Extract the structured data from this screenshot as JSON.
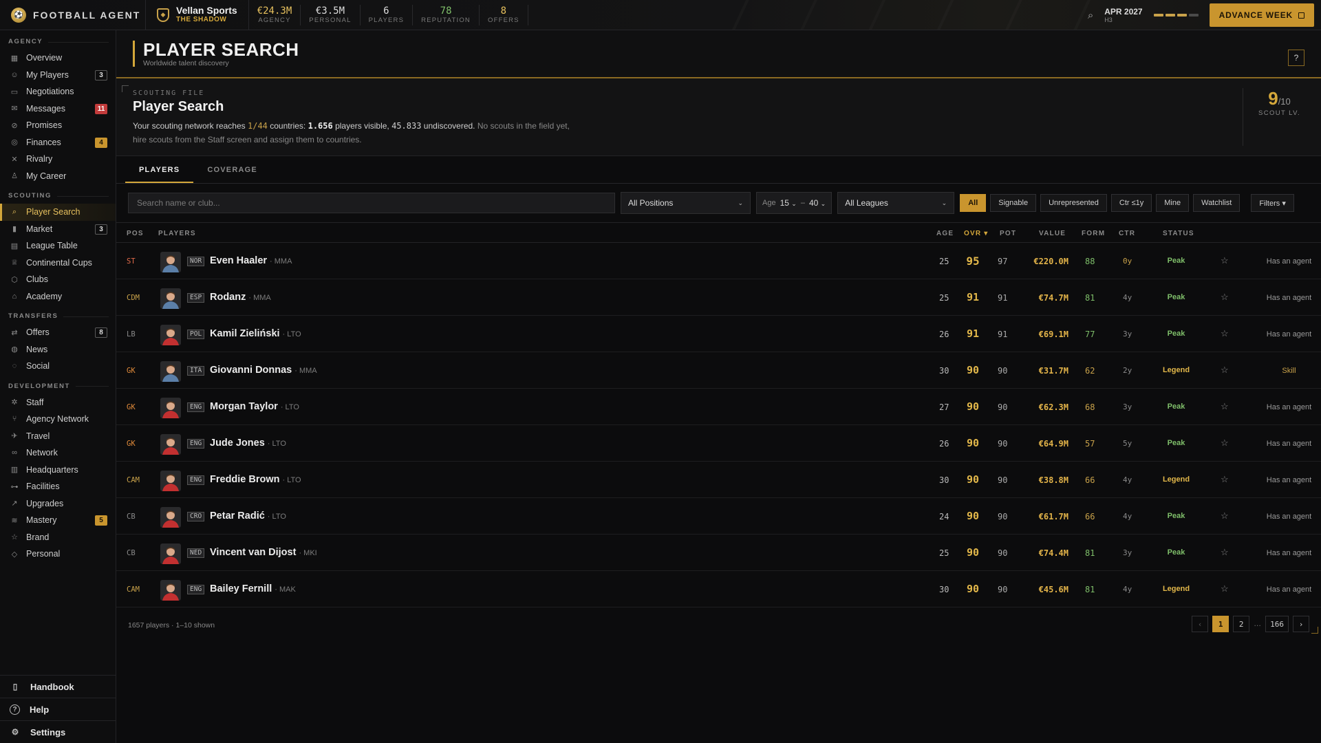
{
  "app": {
    "brand": "FOOTBALL AGENT",
    "logo_icon": "football-icon"
  },
  "agency": {
    "name": "Vellan Sports",
    "tagline": "THE SHADOW"
  },
  "stats": [
    {
      "value": "€24.3M",
      "label": "AGENCY",
      "color": "#e7c15e"
    },
    {
      "value": "€3.5M",
      "label": "PERSONAL",
      "color": "#dddddd"
    },
    {
      "value": "6",
      "label": "PLAYERS",
      "color": "#dddddd"
    },
    {
      "value": "78",
      "label": "REPUTATION",
      "color": "#7fbf6a"
    },
    {
      "value": "8",
      "label": "OFFERS",
      "color": "#e7c15e"
    }
  ],
  "date": {
    "month": "APR 2027",
    "week": "H3",
    "weeks_filled": 3,
    "weeks_total": 4
  },
  "advance_label": "ADVANCE WEEK",
  "sidebar": {
    "sections": [
      {
        "title": "AGENCY",
        "items": [
          {
            "label": "Overview",
            "icon": "grid-icon",
            "glyph": "▦"
          },
          {
            "label": "My Players",
            "icon": "user-icon",
            "glyph": "☺",
            "badge": "3",
            "badge_style": "o"
          },
          {
            "label": "Negotiations",
            "icon": "chat-icon",
            "glyph": "▭"
          },
          {
            "label": "Messages",
            "icon": "mail-icon",
            "glyph": "✉",
            "badge": "11",
            "badge_style": "r"
          },
          {
            "label": "Promises",
            "icon": "link-icon",
            "glyph": "⊘"
          },
          {
            "label": "Finances",
            "icon": "coin-icon",
            "glyph": "◎",
            "badge": "4",
            "badge_style": "y"
          },
          {
            "label": "Rivalry",
            "icon": "swords-icon",
            "glyph": "✕"
          },
          {
            "label": "My Career",
            "icon": "career-icon",
            "glyph": "♙"
          }
        ]
      },
      {
        "title": "SCOUTING",
        "items": [
          {
            "label": "Player Search",
            "icon": "search-icon",
            "glyph": "⌕",
            "active": true
          },
          {
            "label": "Market",
            "icon": "bar-chart-icon",
            "glyph": "▮",
            "badge": "3",
            "badge_style": "o"
          },
          {
            "label": "League Table",
            "icon": "table-icon",
            "glyph": "▤"
          },
          {
            "label": "Continental Cups",
            "icon": "trophy-icon",
            "glyph": "♕"
          },
          {
            "label": "Clubs",
            "icon": "shield-icon",
            "glyph": "⬡"
          },
          {
            "label": "Academy",
            "icon": "academy-icon",
            "glyph": "⌂"
          }
        ]
      },
      {
        "title": "TRANSFERS",
        "items": [
          {
            "label": "Offers",
            "icon": "transfer-icon",
            "glyph": "⇄",
            "badge": "8",
            "badge_style": "o"
          },
          {
            "label": "News",
            "icon": "globe-icon",
            "glyph": "◍"
          },
          {
            "label": "Social",
            "icon": "social-icon",
            "glyph": "◌"
          }
        ]
      },
      {
        "title": "DEVELOPMENT",
        "items": [
          {
            "label": "Staff",
            "icon": "staff-icon",
            "glyph": "✲"
          },
          {
            "label": "Agency Network",
            "icon": "network-icon",
            "glyph": "⑂"
          },
          {
            "label": "Travel",
            "icon": "plane-icon",
            "glyph": "✈"
          },
          {
            "label": "Network",
            "icon": "link-icon",
            "glyph": "∞"
          },
          {
            "label": "Headquarters",
            "icon": "building-icon",
            "glyph": "▥"
          },
          {
            "label": "Facilities",
            "icon": "dumbbell-icon",
            "glyph": "⊶"
          },
          {
            "label": "Upgrades",
            "icon": "trend-icon",
            "glyph": "↗"
          },
          {
            "label": "Mastery",
            "icon": "mastery-icon",
            "glyph": "≋",
            "badge": "5",
            "badge_style": "y"
          },
          {
            "label": "Brand",
            "icon": "star-icon",
            "glyph": "☆"
          },
          {
            "label": "Personal",
            "icon": "diamond-icon",
            "glyph": "◇"
          }
        ]
      }
    ],
    "footer": [
      {
        "label": "Handbook",
        "icon": "book-icon",
        "glyph": "▯"
      },
      {
        "label": "Help",
        "icon": "help-icon",
        "glyph": "?"
      },
      {
        "label": "Settings",
        "icon": "gear-icon",
        "glyph": "⚙"
      }
    ]
  },
  "page": {
    "title": "PLAYER SEARCH",
    "subtitle": "Worldwide talent discovery",
    "help_label": "?"
  },
  "scouting": {
    "label": "SCOUTING FILE",
    "title": "Player Search",
    "text_1": "Your scouting network reaches ",
    "countries": "1/44",
    "text_2": " countries: ",
    "visible": "1.656",
    "text_3": " players visible, ",
    "undiscovered": "45.833",
    "text_4": " undiscovered. ",
    "note": "No scouts in the field yet, hire scouts from the Staff screen and assign them to countries.",
    "level": "9",
    "level_max": "/10",
    "level_label": "SCOUT LV."
  },
  "tabs": [
    "PLAYERS",
    "COVERAGE"
  ],
  "filters": {
    "search_placeholder": "Search name or club...",
    "position": "All Positions",
    "age_label": "Age",
    "age_min": "15",
    "age_sep": "–",
    "age_max": "40",
    "league": "All Leagues",
    "chips": [
      "All",
      "Signable",
      "Unrepresented",
      "Ctr ≤1y",
      "Mine",
      "Watchlist"
    ],
    "more": "Filters ▾"
  },
  "columns": {
    "pos": "POS",
    "players": "PLAYERS",
    "age": "AGE",
    "ovr": "OVR ▾",
    "pot": "POT",
    "value": "VALUE",
    "form": "FORM",
    "ctr": "CTR",
    "status": "STATUS"
  },
  "players": [
    {
      "pos": "ST",
      "nat": "NOR",
      "name": "Even Haaler",
      "club": "· MMA",
      "age": "25",
      "ovr": "95",
      "pot": "97",
      "value": "€220.0M",
      "form": "88",
      "ctr": "0y",
      "status": "Peak",
      "note": "Has an agent",
      "shirt": "#5b7fa8"
    },
    {
      "pos": "CDM",
      "nat": "ESP",
      "name": "Rodanz",
      "club": "· MMA",
      "age": "25",
      "ovr": "91",
      "pot": "91",
      "value": "€74.7M",
      "form": "81",
      "ctr": "4y",
      "status": "Peak",
      "note": "Has an agent",
      "shirt": "#5b7fa8"
    },
    {
      "pos": "LB",
      "nat": "POL",
      "name": "Kamil Zieliński",
      "club": "· LTO",
      "age": "26",
      "ovr": "91",
      "pot": "91",
      "value": "€69.1M",
      "form": "77",
      "ctr": "3y",
      "status": "Peak",
      "note": "Has an agent",
      "shirt": "#c23030"
    },
    {
      "pos": "GK",
      "nat": "ITA",
      "name": "Giovanni Donnas",
      "club": "· MMA",
      "age": "30",
      "ovr": "90",
      "pot": "90",
      "value": "€31.7M",
      "form": "62",
      "ctr": "2y",
      "status": "Legend",
      "note": "Skill",
      "shirt": "#5b7fa8"
    },
    {
      "pos": "GK",
      "nat": "ENG",
      "name": "Morgan Taylor",
      "club": "· LTO",
      "age": "27",
      "ovr": "90",
      "pot": "90",
      "value": "€62.3M",
      "form": "68",
      "ctr": "3y",
      "status": "Peak",
      "note": "Has an agent",
      "shirt": "#c23030"
    },
    {
      "pos": "GK",
      "nat": "ENG",
      "name": "Jude Jones",
      "club": "· LTO",
      "age": "26",
      "ovr": "90",
      "pot": "90",
      "value": "€64.9M",
      "form": "57",
      "ctr": "5y",
      "status": "Peak",
      "note": "Has an agent",
      "shirt": "#c23030"
    },
    {
      "pos": "CAM",
      "nat": "ENG",
      "name": "Freddie Brown",
      "club": "· LTO",
      "age": "30",
      "ovr": "90",
      "pot": "90",
      "value": "€38.8M",
      "form": "66",
      "ctr": "4y",
      "status": "Legend",
      "note": "Has an agent",
      "shirt": "#c23030"
    },
    {
      "pos": "CB",
      "nat": "CRO",
      "name": "Petar Radić",
      "club": "· LTO",
      "age": "24",
      "ovr": "90",
      "pot": "90",
      "value": "€61.7M",
      "form": "66",
      "ctr": "4y",
      "status": "Peak",
      "note": "Has an agent",
      "shirt": "#c23030"
    },
    {
      "pos": "CB",
      "nat": "NED",
      "name": "Vincent van Dijost",
      "club": "· MKI",
      "age": "25",
      "ovr": "90",
      "pot": "90",
      "value": "€74.4M",
      "form": "81",
      "ctr": "3y",
      "status": "Peak",
      "note": "Has an agent",
      "shirt": "#c23030"
    },
    {
      "pos": "CAM",
      "nat": "ENG",
      "name": "Bailey Fernill",
      "club": "· MAK",
      "age": "30",
      "ovr": "90",
      "pot": "90",
      "value": "€45.6M",
      "form": "81",
      "ctr": "4y",
      "status": "Legend",
      "note": "Has an agent",
      "shirt": "#c23030"
    }
  ],
  "footer": {
    "count": "1657 players · 1–10 shown",
    "pages": [
      "‹",
      "1",
      "2",
      "…",
      "166",
      "›"
    ],
    "current": "1"
  },
  "colors": {
    "accent": "#d4a73a",
    "pos_attack": "#e06a4a",
    "pos_mid": "#c9a24a",
    "pos_def": "#8a8a8a",
    "pos_gk": "#e08a3a",
    "peak": "#7fbf6a",
    "legend": "#e3b84a",
    "form_high": "#7fbf6a",
    "form_mid": "#c9a24a"
  }
}
